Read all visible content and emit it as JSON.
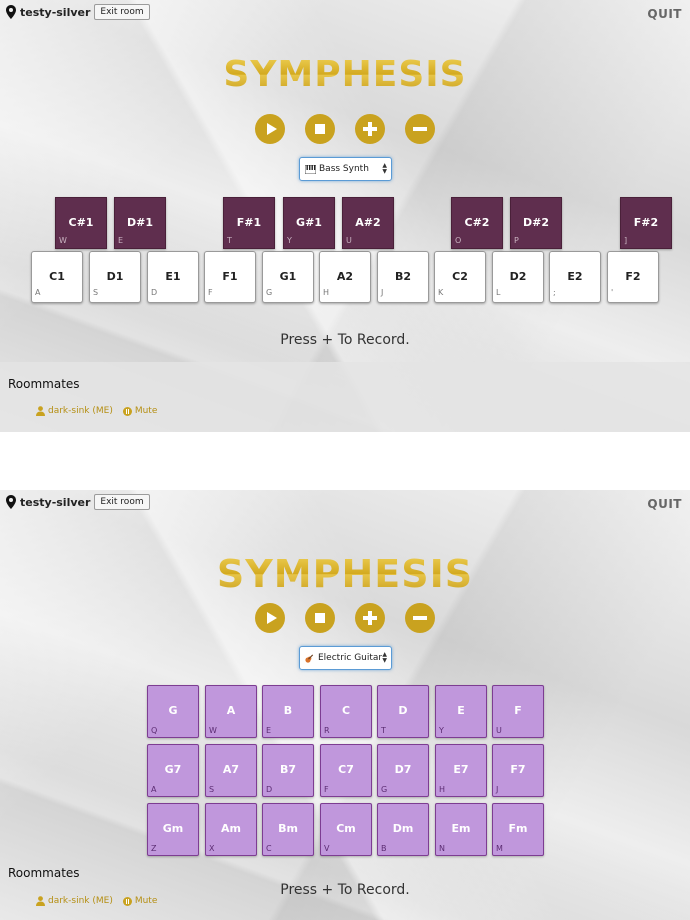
{
  "colors": {
    "accent_gold": "#c9a21f",
    "black_key": "#5f2e4e",
    "chord_pad": "#c097dc",
    "chord_border": "#7d3d92"
  },
  "panels": [
    {
      "room_name": "testy-silver",
      "exit_label": "Exit room",
      "quit_label": "QUIT",
      "logo_text": "SYMPHESIS",
      "controls": [
        "play-icon",
        "stop-icon",
        "plus-icon",
        "minus-icon"
      ],
      "instrument": {
        "icon": "piano-icon",
        "selected": "Bass Synth"
      },
      "black_keys": [
        {
          "note": "C#1",
          "key": "W"
        },
        {
          "note": "D#1",
          "key": "E"
        },
        {
          "note": "F#1",
          "key": "T"
        },
        {
          "note": "G#1",
          "key": "Y"
        },
        {
          "note": "A#2",
          "key": "U"
        },
        {
          "note": "C#2",
          "key": "O"
        },
        {
          "note": "D#2",
          "key": "P"
        },
        {
          "note": "F#2",
          "key": "]"
        }
      ],
      "white_keys": [
        {
          "note": "C1",
          "key": "A"
        },
        {
          "note": "D1",
          "key": "S"
        },
        {
          "note": "E1",
          "key": "D"
        },
        {
          "note": "F1",
          "key": "F"
        },
        {
          "note": "G1",
          "key": "G"
        },
        {
          "note": "A2",
          "key": "H"
        },
        {
          "note": "B2",
          "key": "J"
        },
        {
          "note": "C2",
          "key": "K"
        },
        {
          "note": "D2",
          "key": "L"
        },
        {
          "note": "E2",
          "key": ";"
        },
        {
          "note": "F2",
          "key": "'"
        }
      ],
      "record_message": "Press + To Record.",
      "roommates_title": "Roommates",
      "roommate": "dark-sink (ME)",
      "mute_label": "Mute"
    },
    {
      "room_name": "testy-silver",
      "exit_label": "Exit room",
      "quit_label": "QUIT",
      "logo_text": "SYMPHESIS",
      "controls": [
        "play-icon",
        "stop-icon",
        "plus-icon",
        "minus-icon"
      ],
      "instrument": {
        "icon": "guitar-icon",
        "selected": "Electric Guitar"
      },
      "chords": [
        [
          {
            "note": "G",
            "key": "Q"
          },
          {
            "note": "A",
            "key": "W"
          },
          {
            "note": "B",
            "key": "E"
          },
          {
            "note": "C",
            "key": "R"
          },
          {
            "note": "D",
            "key": "T"
          },
          {
            "note": "E",
            "key": "Y"
          },
          {
            "note": "F",
            "key": "U"
          }
        ],
        [
          {
            "note": "G7",
            "key": "A"
          },
          {
            "note": "A7",
            "key": "S"
          },
          {
            "note": "B7",
            "key": "D"
          },
          {
            "note": "C7",
            "key": "F"
          },
          {
            "note": "D7",
            "key": "G"
          },
          {
            "note": "E7",
            "key": "H"
          },
          {
            "note": "F7",
            "key": "J"
          }
        ],
        [
          {
            "note": "Gm",
            "key": "Z"
          },
          {
            "note": "Am",
            "key": "X"
          },
          {
            "note": "Bm",
            "key": "C"
          },
          {
            "note": "Cm",
            "key": "V"
          },
          {
            "note": "Dm",
            "key": "B"
          },
          {
            "note": "Em",
            "key": "N"
          },
          {
            "note": "Fm",
            "key": "M"
          }
        ]
      ],
      "record_message": "Press + To Record.",
      "roommates_title": "Roommates",
      "roommate": "dark-sink (ME)",
      "mute_label": "Mute"
    }
  ]
}
